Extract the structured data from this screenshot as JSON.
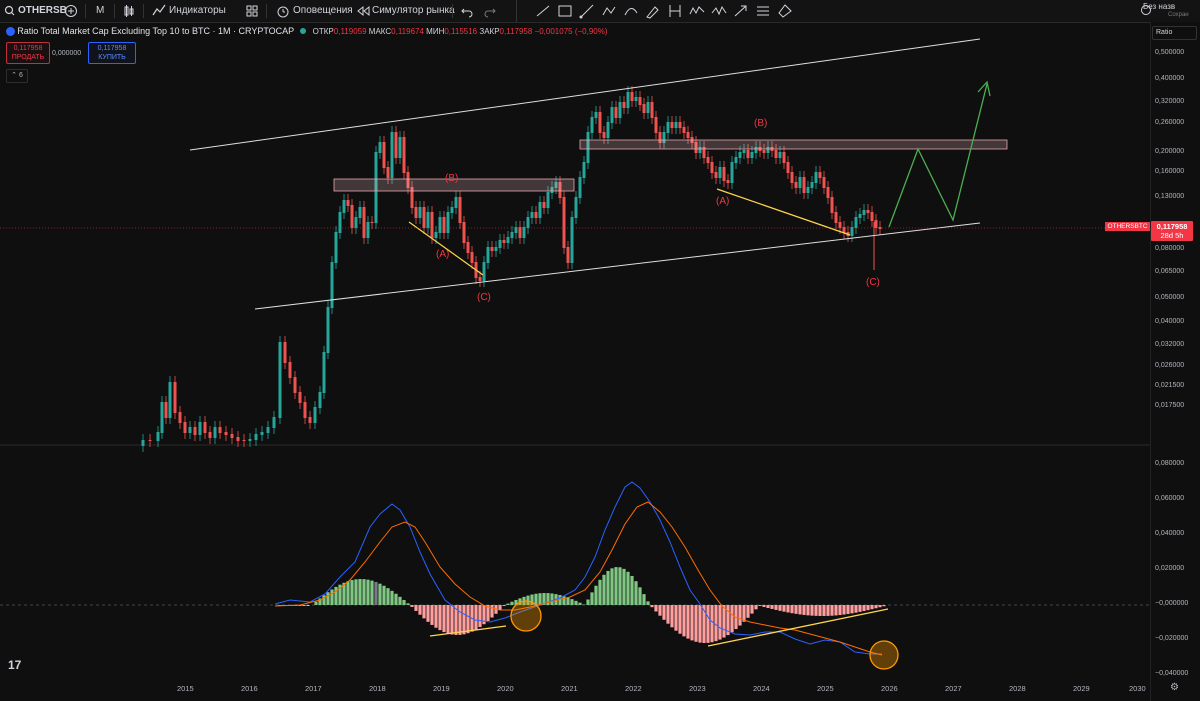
{
  "toolbar": {
    "symbol": "OTHERSB",
    "interval": "M",
    "indicators": "Индикаторы",
    "alerts": "Оповещения",
    "replay": "Симулятор рынка",
    "title_right": "Без назв",
    "save_label": "Сохран"
  },
  "legend": {
    "title": "Ratio Total Market Cap Excluding Top 10 to BTC · 1M · CRYPTOCAP",
    "open_label": "ОТКР",
    "open": "0,119059",
    "high_label": "МАКС",
    "high": "0,119674",
    "low_label": "МИН",
    "low": "0,115516",
    "close_label": "ЗАКР",
    "close": "0,117958",
    "change": "−0,001075 (−0,90%)"
  },
  "trade": {
    "sell_price": "0,117958",
    "sell_label": "ПРОДАТЬ",
    "spread": "0,000000",
    "buy_price": "0,117958",
    "buy_label": "КУПИТЬ",
    "indicator_count": "6"
  },
  "price_axis": {
    "scale_label": "Ratio",
    "ticks": [
      "0,500000",
      "0,400000",
      "0,320000",
      "0,260000",
      "0,200000",
      "0,160000",
      "0,130000",
      "0,100000",
      "0,080000",
      "0,065000",
      "0,050000",
      "0,040000",
      "0,032000",
      "0,026000",
      "0,021500",
      "0,017500"
    ],
    "current_symbol": "OTHERSBTC",
    "current_price": "0,117958",
    "countdown": "28d 5h"
  },
  "macd_axis": {
    "ticks": [
      "0,080000",
      "0,060000",
      "0,040000",
      "0,020000",
      "−0,000000",
      "−0,020000",
      "−0,040000"
    ]
  },
  "time_axis": {
    "years": [
      "2015",
      "2016",
      "2017",
      "2018",
      "2019",
      "2020",
      "2021",
      "2022",
      "2023",
      "2024",
      "2025",
      "2026",
      "2027",
      "2028",
      "2029",
      "2030"
    ]
  },
  "annotations": [
    "(A)",
    "(B)",
    "(C)",
    "(B)",
    "(A)",
    "(B)",
    "(C)"
  ],
  "colors": {
    "up": "#26a69a",
    "down": "#ef5350",
    "macd": "#2962ff",
    "signal": "#ff6d00",
    "hist_pos": "#4caf50",
    "hist_neg": "#ff9e9e",
    "trend": "#ffd54f",
    "projection": "#4caf50"
  },
  "logo_text": "17"
}
